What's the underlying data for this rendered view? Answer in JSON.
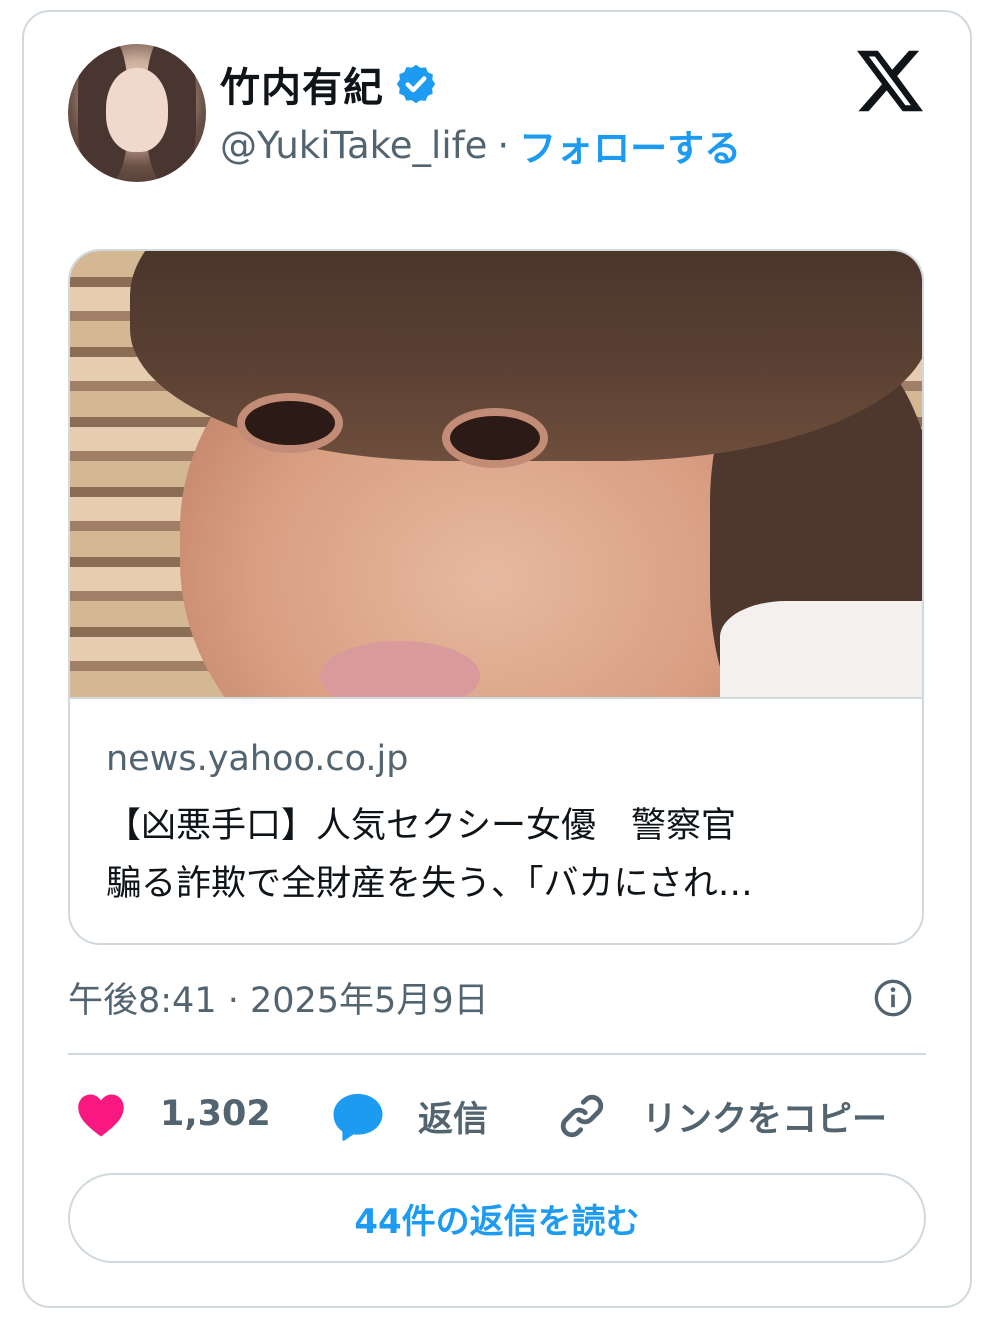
{
  "author": {
    "display_name": "竹内有紀",
    "handle": "@YukiTake_life",
    "separator": "·",
    "follow_label": "フォローする",
    "verified_color": "#1d9bf0"
  },
  "link_card": {
    "domain": "news.yahoo.co.jp",
    "headline_line1": "【凶悪手口】人気セクシー女優　警察官",
    "headline_line2": "騙る詐欺で全財産を失う、「バカにされ…"
  },
  "meta": {
    "timestamp": "午後8:41 · 2025年5月9日"
  },
  "actions": {
    "like_count": "1,302",
    "reply_label": "返信",
    "copy_link_label": "リンクをコピー"
  },
  "read_replies_label": "44件の返信を読む",
  "colors": {
    "accent": "#1d9bf0",
    "like": "#f91880",
    "secondary_text": "#536471",
    "border": "#cfd9de"
  }
}
